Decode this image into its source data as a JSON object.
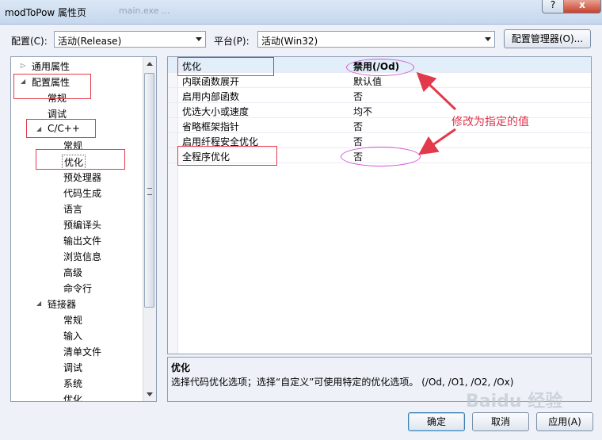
{
  "window": {
    "title": "modToPow 属性页",
    "ghost_title": "main.exe  ...",
    "help_label": "?",
    "close_label": "x"
  },
  "toolbar": {
    "config_label": "配置(C):",
    "config_value": "活动(Release)",
    "platform_label": "平台(P):",
    "platform_value": "活动(Win32)",
    "manager_button": "配置管理器(O)..."
  },
  "tree": {
    "items": [
      {
        "label": "通用属性"
      },
      {
        "label": "配置属性"
      },
      {
        "label": "常规"
      },
      {
        "label": "调试"
      },
      {
        "label": "C/C++"
      },
      {
        "label": "常规"
      },
      {
        "label": "优化"
      },
      {
        "label": "预处理器"
      },
      {
        "label": "代码生成"
      },
      {
        "label": "语言"
      },
      {
        "label": "预编译头"
      },
      {
        "label": "输出文件"
      },
      {
        "label": "浏览信息"
      },
      {
        "label": "高级"
      },
      {
        "label": "命令行"
      },
      {
        "label": "链接器"
      },
      {
        "label": "常规"
      },
      {
        "label": "输入"
      },
      {
        "label": "清单文件"
      },
      {
        "label": "调试"
      },
      {
        "label": "系统"
      },
      {
        "label": "优化"
      }
    ]
  },
  "properties": {
    "rows": [
      {
        "name": "优化",
        "value": "禁用(/Od)"
      },
      {
        "name": "内联函数展开",
        "value": "默认值"
      },
      {
        "name": "启用内部函数",
        "value": "否"
      },
      {
        "name": "优选大小或速度",
        "value": "均不"
      },
      {
        "name": "省略框架指针",
        "value": "否"
      },
      {
        "name": "启用纤程安全优化",
        "value": "否"
      },
      {
        "name": "全程序优化",
        "value": "否"
      }
    ]
  },
  "description": {
    "title": "优化",
    "text": "选择代码优化选项；选择“自定义”可使用特定的优化选项。      (/Od, /O1, /O2, /Ox)"
  },
  "buttons": {
    "ok": "确定",
    "cancel": "取消",
    "apply": "应用(A)"
  },
  "annotation": {
    "note": "修改为指定的值"
  },
  "watermark": "Baidu 经验",
  "colors": {
    "annotation_red": "#e23a4a",
    "annotation_pink": "#d356d3"
  }
}
